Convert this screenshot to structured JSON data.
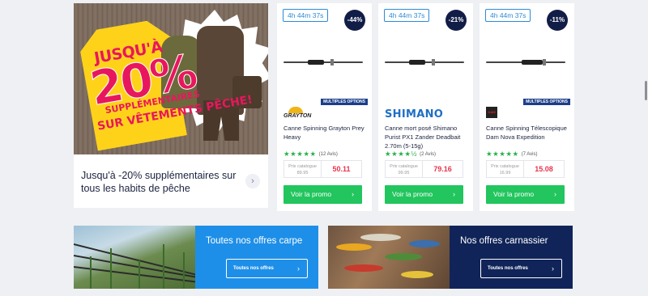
{
  "promo": {
    "image_lines": {
      "line1": "JUSQU'À",
      "line2": "20%",
      "line3": "SUPPLÉMENTAIRES",
      "line4": "SUR VÊTEMENTS PÊCHE!"
    },
    "text": "Jusqu'à -20% supplémentaires sur tous les habits de pêche",
    "arrow_icon": "chevron-right-icon"
  },
  "products": [
    {
      "timer": "4h 44m 37s",
      "discount": "-44%",
      "badge": "",
      "brand": "GRAYTON",
      "name": "Canne Spinning Grayton Prey Heavy",
      "stars": "★★★★★",
      "reviews": "(12 Avis)",
      "catalog_label": "Prix catalogue",
      "catalog_price": "89.95",
      "price": "50.11",
      "cta": "Voir la promo"
    },
    {
      "timer": "4h 44m 37s",
      "discount": "-21%",
      "badge": "",
      "brand": "SHIMANO",
      "name": "Canne mort posé Shimano Purist PX1 Zander Deadbait 2.70m (5-15g)",
      "stars": "★★★★½",
      "reviews": "(2 Avis)",
      "catalog_label": "Prix catalogue",
      "catalog_price": "99.95",
      "price": "79.16",
      "cta": "Voir la promo"
    },
    {
      "timer": "4h 44m 37s",
      "discount": "-11%",
      "badge": "MULTIPLES OPTIONS",
      "brand": "DAM",
      "name": "Canne Spinning Télescopique Dam Nova Expedition",
      "stars": "★★★★★",
      "reviews": "(7 Avis)",
      "catalog_label": "Prix catalogue",
      "catalog_price": "16.99",
      "price": "15.08",
      "cta": "Voir la promo"
    }
  ],
  "multi_badge_first": "MULTIPLES OPTIONS",
  "banners": [
    {
      "title": "Toutes nos offres carpe",
      "button": "Toutes nos offres",
      "color": "#1e8fe8"
    },
    {
      "title": "Nos offres carnassier",
      "button": "Toutes nos offres",
      "color": "#102459"
    }
  ],
  "colors": {
    "accent_green": "#22c55e",
    "price_red": "#e8334c",
    "navy": "#121d47"
  }
}
